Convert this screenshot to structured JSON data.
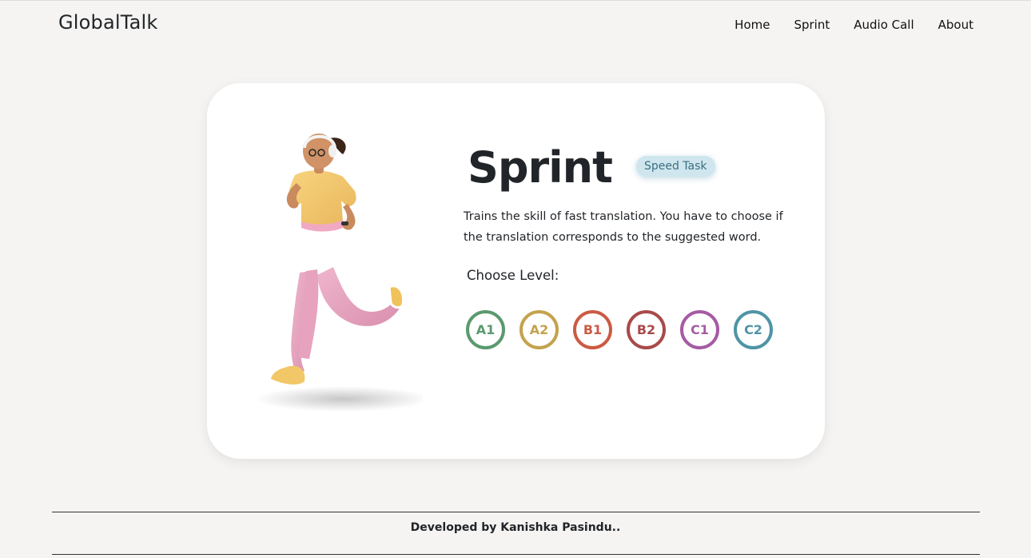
{
  "nav": {
    "brand": "GlobalTalk",
    "links": [
      "Home",
      "Sprint",
      "Audio Call",
      "About"
    ]
  },
  "game": {
    "title": "Sprint",
    "badge": "Speed Task",
    "description": "Trains the skill of fast translation. You have to choose if the translation corresponds to the suggested word.",
    "choose_label": "Choose Level:",
    "levels": [
      {
        "label": "A1",
        "color": "#5a9a6e"
      },
      {
        "label": "A2",
        "color": "#c4a24e"
      },
      {
        "label": "B1",
        "color": "#cc5a44"
      },
      {
        "label": "B2",
        "color": "#a94a4a"
      },
      {
        "label": "C1",
        "color": "#a55ba3"
      },
      {
        "label": "C2",
        "color": "#4f94a6"
      }
    ]
  },
  "footer": {
    "text": "Developed by Kanishka Pasindu.."
  },
  "colors": {
    "background": "#f5f4f2",
    "card": "#ffffff",
    "badge_bg": "#cfe6ee",
    "badge_text": "#3a6f80"
  }
}
